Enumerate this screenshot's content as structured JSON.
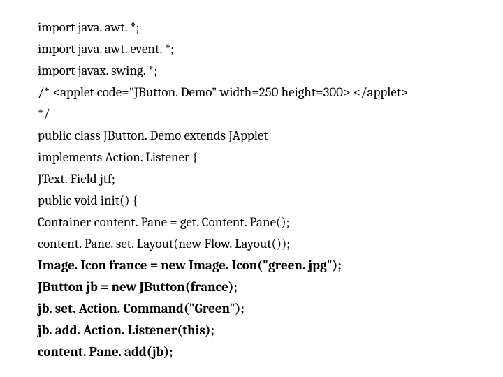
{
  "code": {
    "lines": [
      {
        "text": "import java. awt. *;",
        "bold": false
      },
      {
        "text": "import java. awt. event. *;",
        "bold": false
      },
      {
        "text": "import javax. swing. *;",
        "bold": false
      },
      {
        "text": "/* <applet code=\"JButton. Demo\" width=250 height=300> </applet>",
        "bold": false
      },
      {
        "text": "*/",
        "bold": false
      },
      {
        "text": "public class JButton. Demo extends JApplet",
        "bold": false
      },
      {
        "text": "implements Action. Listener {",
        "bold": false
      },
      {
        "text": "JText. Field jtf;",
        "bold": false
      },
      {
        "text": "public void init() {",
        "bold": false
      },
      {
        "text": "Container content. Pane = get. Content. Pane();",
        "bold": false
      },
      {
        "text": "content. Pane. set. Layout(new Flow. Layout());",
        "bold": false
      },
      {
        "text": "Image. Icon france = new Image. Icon(\"green. jpg\");",
        "bold": true
      },
      {
        "text": "JButton jb = new JButton(france);",
        "bold": true
      },
      {
        "text": "jb. set. Action. Command(\"Green\");",
        "bold": true
      },
      {
        "text": "jb. add. Action. Listener(this);",
        "bold": true
      },
      {
        "text": "content. Pane. add(jb);",
        "bold": true
      }
    ]
  }
}
